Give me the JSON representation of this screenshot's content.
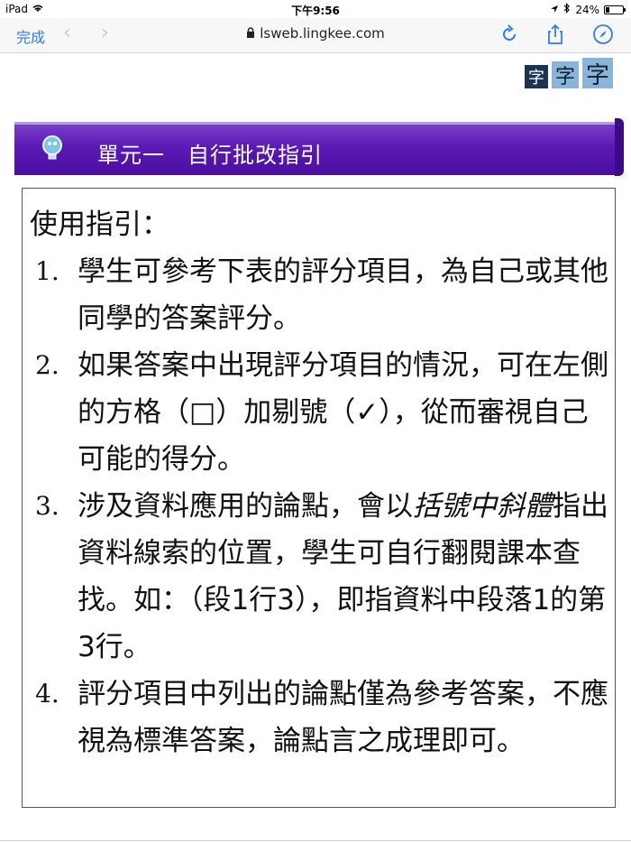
{
  "status_bar": {
    "device": "iPad",
    "time": "下午9:56",
    "battery": "24%",
    "battery_level": 0.24
  },
  "browser": {
    "done_label": "完成",
    "url": "lsweb.lingkee.com"
  },
  "text_size_buttons": [
    "字",
    "字",
    "字"
  ],
  "banner": {
    "title": "單元一　自行批改指引"
  },
  "guide": {
    "heading": "使用指引：",
    "items": [
      {
        "num": "1.",
        "text": "學生可參考下表的評分項目，為自己或其他同學的答案評分。"
      },
      {
        "num": "2.",
        "text": "如果答案中出現評分項目的情況，可在左側的方格（□）加剔號（✓），從而審視自己可能的得分。"
      },
      {
        "num": "3.",
        "text_before": "涉及資料應用的論點，會以",
        "italic": "括號中斜體",
        "text_after": "指出資料線索的位置，學生可自行翻閱課本查找。如：（段1行3），即指資料中段落1的第3行。"
      },
      {
        "num": "4.",
        "text": "評分項目中列出的論點僅為參考答案，不應視為標準答案，論點言之成理即可。"
      }
    ]
  },
  "colors": {
    "banner_purple": "#5a19b4",
    "link_blue": "#2f7cf6"
  }
}
